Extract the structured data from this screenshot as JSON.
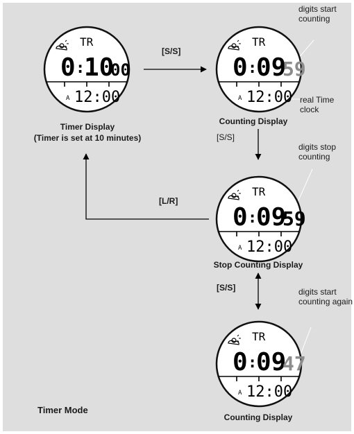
{
  "colors": {
    "panel": "#dedede",
    "accent": "#ffffff",
    "dim_digits": "#8c8c8c",
    "ink": "#000000"
  },
  "icons": [
    "weather-icon"
  ],
  "displays": [
    {
      "mode": "TR",
      "hours": "0",
      "colon": ":",
      "minutes": "10",
      "seconds": "00",
      "seconds_style": "small-black",
      "alarm_flag": "A",
      "clock": "12:00",
      "title": "Timer Display",
      "subtitle": "(Timer is set at 10 minutes)"
    },
    {
      "mode": "TR",
      "hours": "0",
      "colon": ":",
      "minutes": "09",
      "seconds": "59",
      "seconds_style": "gray",
      "alarm_flag": "A",
      "clock": "12:00",
      "title": "Counting Display"
    },
    {
      "mode": "TR",
      "hours": "0",
      "colon": ":",
      "minutes": "09",
      "seconds": "59",
      "seconds_style": "black",
      "alarm_flag": "A",
      "clock": "12:00",
      "title": "Stop Counting Display"
    },
    {
      "mode": "TR",
      "hours": "0",
      "colon": ":",
      "minutes": "09",
      "seconds": "47",
      "seconds_style": "gray",
      "alarm_flag": "A",
      "clock": "12:00",
      "title": "Counting Display"
    }
  ],
  "buttons": {
    "ss_1": "[S/S]",
    "ss_2": "[S/S]",
    "lr": "[L/R]",
    "ss_3": "[S/S]"
  },
  "annotations": {
    "start_1": "digits start counting",
    "real_time": "real Time clock",
    "stop": "digits stop counting",
    "start_again": "digits start counting again"
  },
  "mode_label": "Timer Mode"
}
